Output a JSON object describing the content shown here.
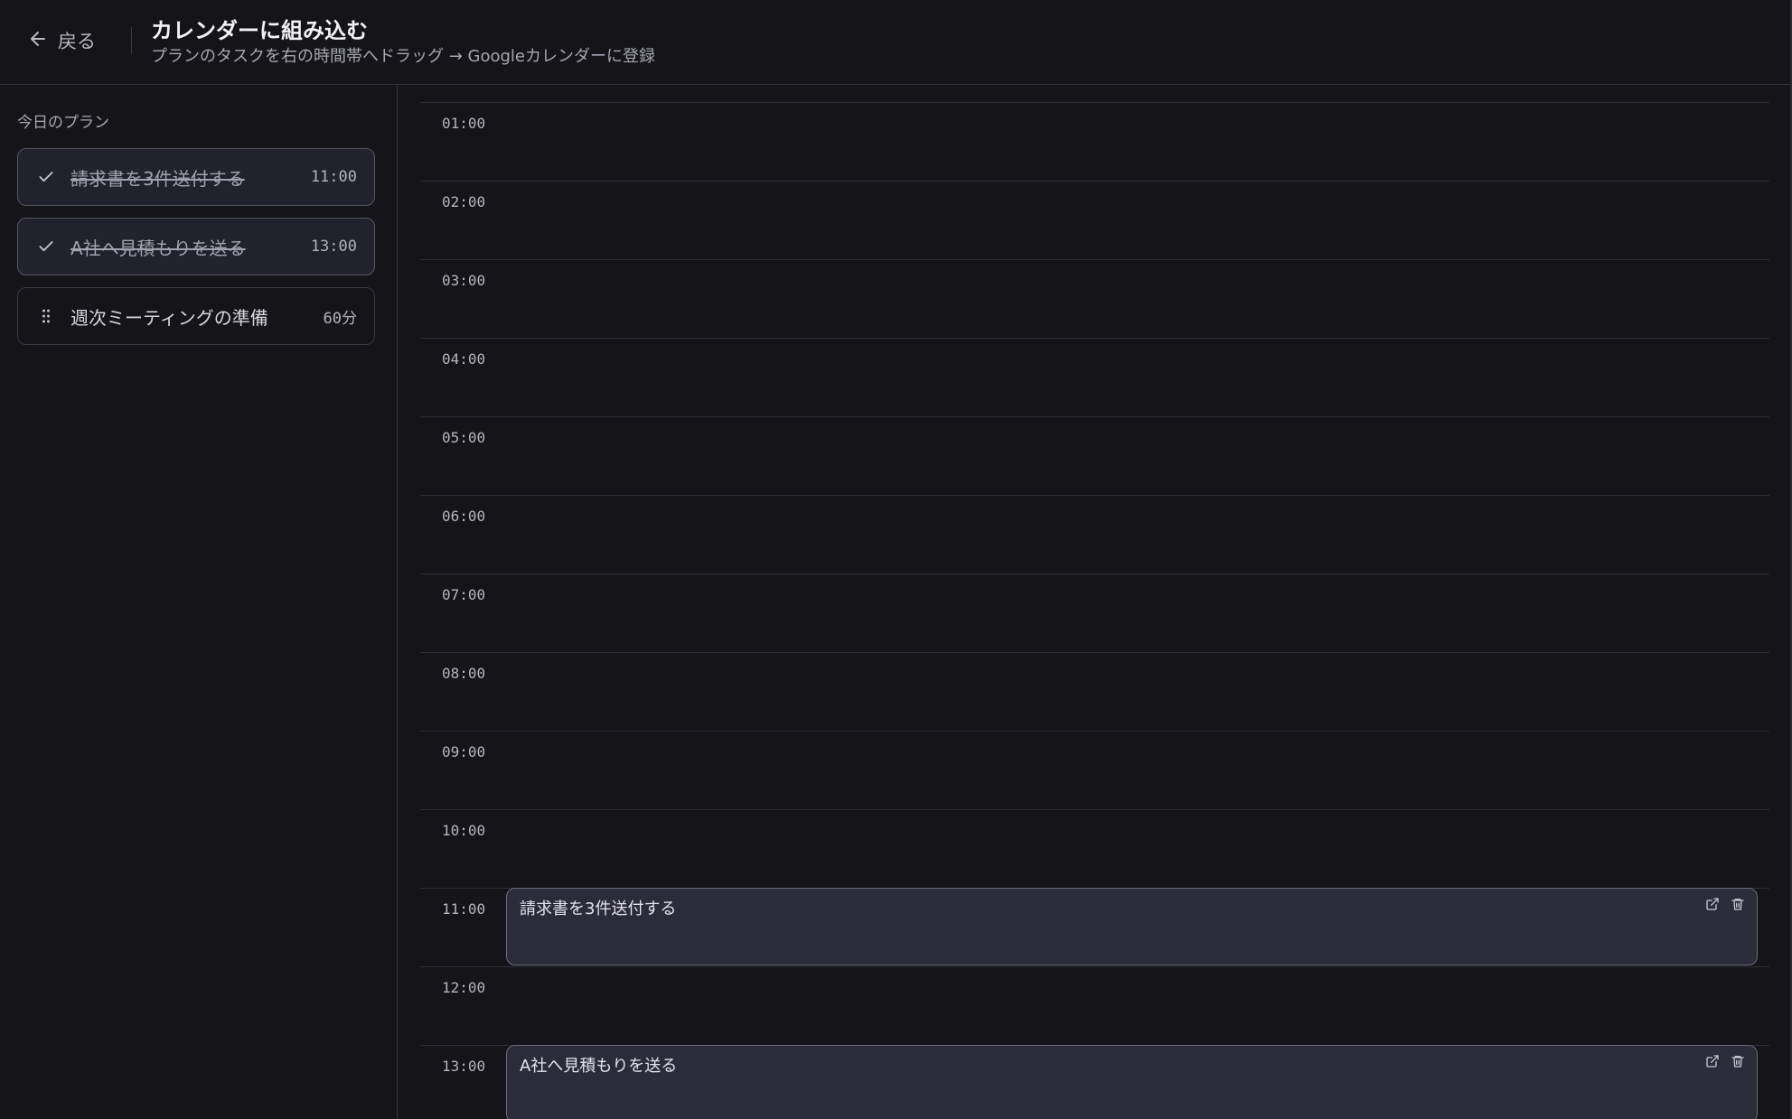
{
  "header": {
    "back_label": "戻る",
    "title": "カレンダーに組み込む",
    "subtitle": "プランのタスクを右の時間帯へドラッグ → Googleカレンダーに登録"
  },
  "sidebar": {
    "title": "今日のプラン",
    "items": [
      {
        "label": "請求書を3件送付する",
        "meta": "11:00",
        "done": true,
        "icon": "check-icon"
      },
      {
        "label": "A社へ見積もりを送る",
        "meta": "13:00",
        "done": true,
        "icon": "check-icon"
      },
      {
        "label": "週次ミーティングの準備",
        "meta": "60分",
        "done": false,
        "icon": "drag-handle-icon"
      }
    ]
  },
  "calendar": {
    "hours": [
      "01:00",
      "02:00",
      "03:00",
      "04:00",
      "05:00",
      "06:00",
      "07:00",
      "08:00",
      "09:00",
      "10:00",
      "11:00",
      "12:00",
      "13:00"
    ],
    "events": [
      {
        "title": "請求書を3件送付する",
        "start": "11:00"
      },
      {
        "title": "A社へ見積もりを送る",
        "start": "13:00"
      }
    ]
  }
}
